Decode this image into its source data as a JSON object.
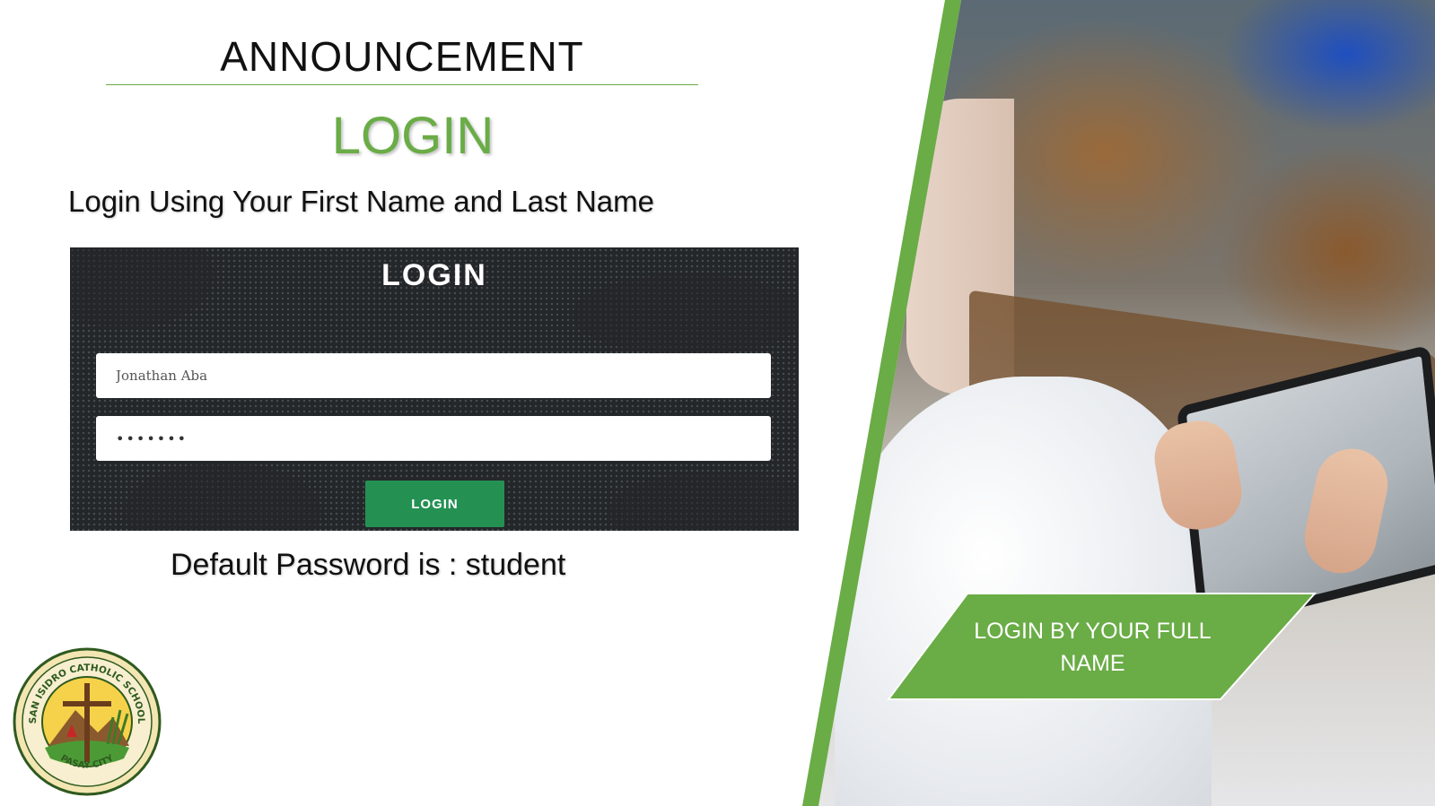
{
  "announcement": {
    "title": "ANNOUNCEMENT",
    "login_heading": "LOGIN",
    "instruction": "Login Using Your First Name and Last Name",
    "default_password_note": "Default Password is : student"
  },
  "login_form": {
    "title": "LOGIN",
    "username_value": "Jonathan Aba",
    "password_value": "•••••••",
    "button_label": "LOGIN"
  },
  "seal": {
    "top_text": "SAN ISIDRO CATHOLIC SCHOOL",
    "bottom_text": "PASAY CITY"
  },
  "callout": {
    "text_line1": "LOGIN BY YOUR FULL",
    "text_line2": "NAME"
  },
  "colors": {
    "accent_green": "#6aac46",
    "button_green": "#249153",
    "form_background": "#24272a"
  }
}
